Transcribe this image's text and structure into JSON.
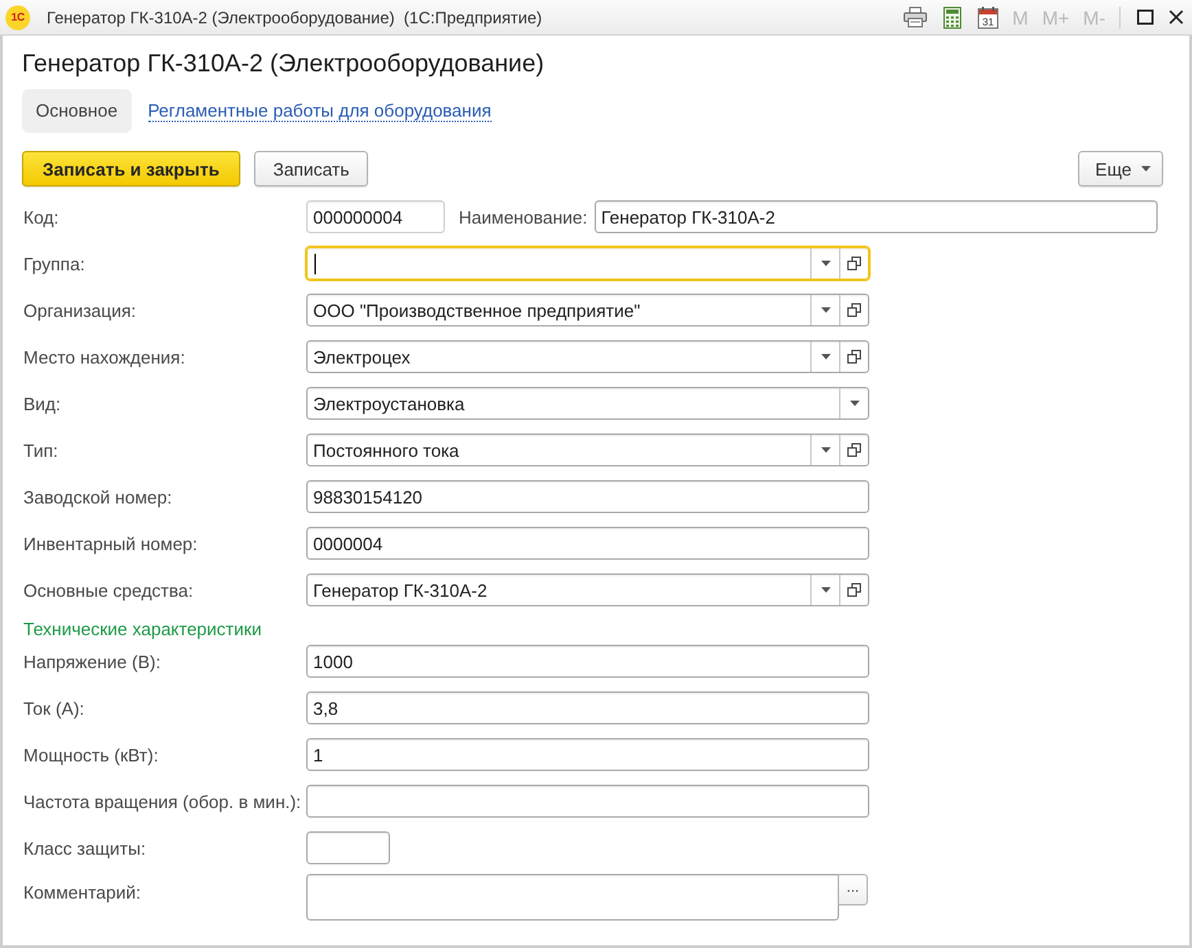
{
  "window": {
    "logo": "1С",
    "title": "Генератор ГК-310А-2 (Электрооборудование)  (1С:Предприятие)",
    "calendar_day": "31",
    "memory_buttons": [
      {
        "label": "M",
        "disabled": true
      },
      {
        "label": "M+",
        "disabled": true
      },
      {
        "label": "M-",
        "disabled": true
      }
    ]
  },
  "form_title": "Генератор ГК-310А-2 (Электрооборудование)",
  "tabs": [
    {
      "label": "Основное",
      "selected": true
    },
    {
      "label": "Регламентные работы для оборудования",
      "selected": false
    }
  ],
  "command_bar": {
    "buttons": [
      {
        "label": "Записать и закрыть",
        "kind": "primary"
      },
      {
        "label": "Записать",
        "kind": "normal"
      }
    ],
    "more": {
      "label": "Еще"
    }
  },
  "fields": [
    {
      "label": "Код:",
      "kind": "code",
      "value": "000000004",
      "focused": false,
      "name_label": "Наименование:",
      "name_value": "Генератор ГК-310А-2"
    },
    {
      "label": "Группа:",
      "kind": "select",
      "open_button": true,
      "focused": true
    },
    {
      "label": "Организация:",
      "kind": "select",
      "value": "ООО \"Производственное предприятие\"",
      "open_button": true,
      "focused": false
    },
    {
      "label": "Место нахождения:",
      "kind": "select",
      "value": "Электроцех",
      "open_button": true,
      "focused": false
    },
    {
      "label": "Вид:",
      "kind": "select",
      "value": "Электроустановка",
      "open_button": false,
      "focused": false
    },
    {
      "label": "Тип:",
      "kind": "select",
      "value": "Постоянного тока",
      "open_button": true,
      "focused": false
    },
    {
      "label": "Заводской номер:",
      "kind": "text",
      "value": "98830154120",
      "focused": false
    },
    {
      "label": "Инвентарный номер:",
      "kind": "text",
      "value": "0000004",
      "focused": false
    },
    {
      "label": "Основные средства:",
      "kind": "select",
      "value": "Генератор ГК-310А-2",
      "open_button": true,
      "focused": false
    }
  ],
  "tech_section": {
    "title": "Технические характеристики",
    "fields": [
      {
        "label": "Напряжение (В):",
        "kind": "text",
        "value": "1000",
        "focused": false
      },
      {
        "label": "Ток (А):",
        "kind": "text",
        "value": "3,8",
        "focused": false
      },
      {
        "label": "Мощность (кВт):",
        "kind": "text",
        "value": "1",
        "focused": false
      },
      {
        "label": "Частота вращения (обор. в мин.):",
        "kind": "text",
        "focused": false
      },
      {
        "label": "Класс защиты:",
        "kind": "short",
        "focused": false
      },
      {
        "label": "Комментарий:",
        "kind": "memo",
        "button": "...",
        "focused": false
      }
    ]
  }
}
